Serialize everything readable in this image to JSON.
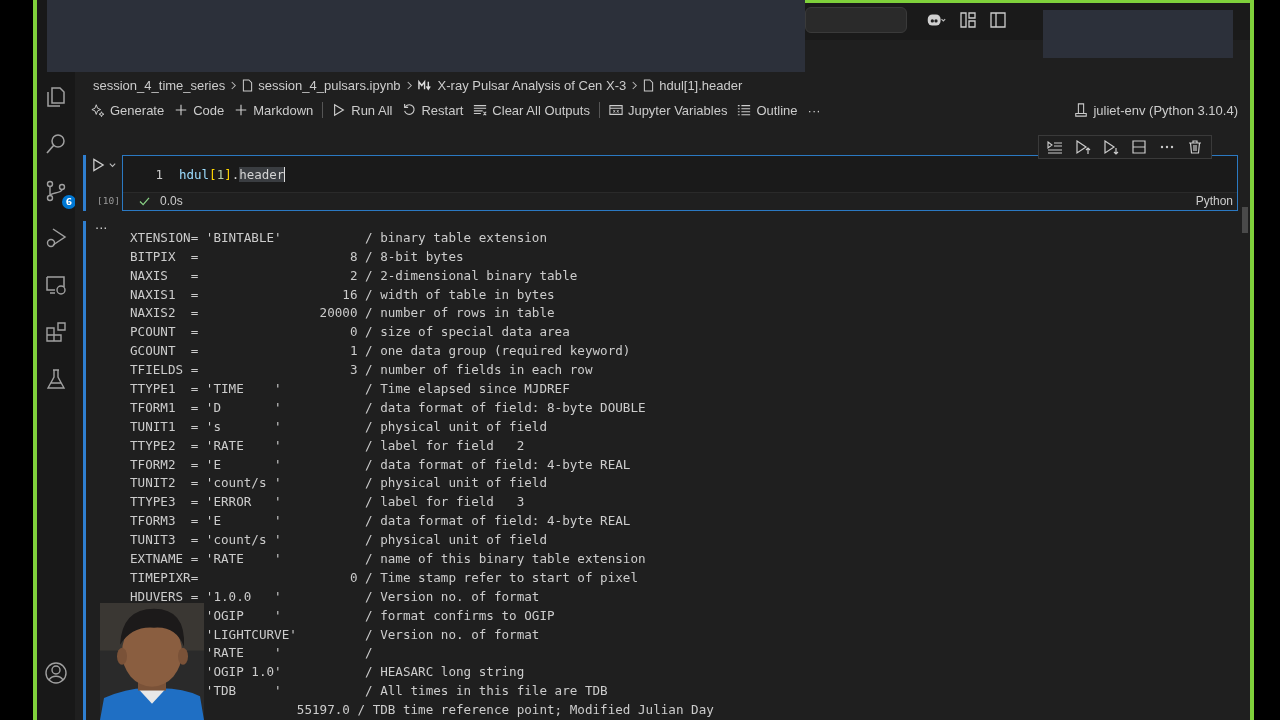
{
  "activity_bar": {
    "source_control_badge": "6"
  },
  "breadcrumbs": [
    {
      "text": "session_4_time_series",
      "kind": "folder"
    },
    {
      "text": "session_4_pulsars.ipynb",
      "kind": "file"
    },
    {
      "text": "X-ray Pulsar Analysis of Cen X-3",
      "kind": "markdown"
    },
    {
      "text": "hdul[1].header",
      "kind": "file"
    }
  ],
  "toolbar": [
    {
      "label": "Generate",
      "kind": "sparkle",
      "separator_before": false
    },
    {
      "label": "Code",
      "kind": "plus",
      "separator_before": false
    },
    {
      "label": "Markdown",
      "kind": "plus",
      "separator_before": false
    },
    {
      "label": "Run All",
      "kind": "run",
      "separator_before": true
    },
    {
      "label": "Restart",
      "kind": "restart",
      "separator_before": false
    },
    {
      "label": "Clear All Outputs",
      "kind": "clear",
      "separator_before": false
    },
    {
      "label": "Jupyter Variables",
      "kind": "variables",
      "separator_before": true
    },
    {
      "label": "Outline",
      "kind": "outline",
      "separator_before": false
    },
    {
      "label": "···",
      "kind": "more",
      "separator_before": false
    }
  ],
  "kernel": "juliet-env (Python 3.10.4)",
  "cell": {
    "line_number": "1",
    "code": [
      {
        "text": "hdul",
        "kind": "variable"
      },
      {
        "text": "[",
        "kind": "bracket"
      },
      {
        "text": "1",
        "kind": "number"
      },
      {
        "text": "]",
        "kind": "bracket"
      },
      {
        "text": ".",
        "kind": "plain"
      },
      {
        "text": "header",
        "kind": "selected"
      }
    ],
    "execution_count": "[10]",
    "succeeded": true,
    "duration": "0.0s",
    "language": "Python"
  },
  "output": {
    "more": "···",
    "lines": [
      "XTENSION= 'BINTABLE'           / binary table extension",
      "BITPIX  =                    8 / 8-bit bytes",
      "NAXIS   =                    2 / 2-dimensional binary table",
      "NAXIS1  =                   16 / width of table in bytes",
      "NAXIS2  =                20000 / number of rows in table",
      "PCOUNT  =                    0 / size of special data area",
      "GCOUNT  =                    1 / one data group (required keyword)",
      "TFIELDS =                    3 / number of fields in each row",
      "TTYPE1  = 'TIME    '           / Time elapsed since MJDREF",
      "TFORM1  = 'D       '           / data format of field: 8-byte DOUBLE",
      "TUNIT1  = 's       '           / physical unit of field",
      "TTYPE2  = 'RATE    '           / label for field   2",
      "TFORM2  = 'E       '           / data format of field: 4-byte REAL",
      "TUNIT2  = 'count/s '           / physical unit of field",
      "TTYPE3  = 'ERROR   '           / label for field   3",
      "TFORM3  = 'E       '           / data format of field: 4-byte REAL",
      "TUNIT3  = 'count/s '           / physical unit of field",
      "EXTNAME = 'RATE    '           / name of this binary table extension",
      "TIMEPIXR=                    0 / Time stamp refer to start of pixel",
      "HDUVERS = '1.0.0   '           / Version no. of format",
      "          'OGIP    '           / format confirms to OGIP",
      "          'LIGHTCURVE'         / Version no. of format",
      "          'RATE    '           /",
      "          'OGIP 1.0'           / HEASARC long string",
      "          'TDB     '           / All times in this file are TDB",
      "                      55197.0 / TDB time reference point; Modified Julian Day"
    ]
  }
}
